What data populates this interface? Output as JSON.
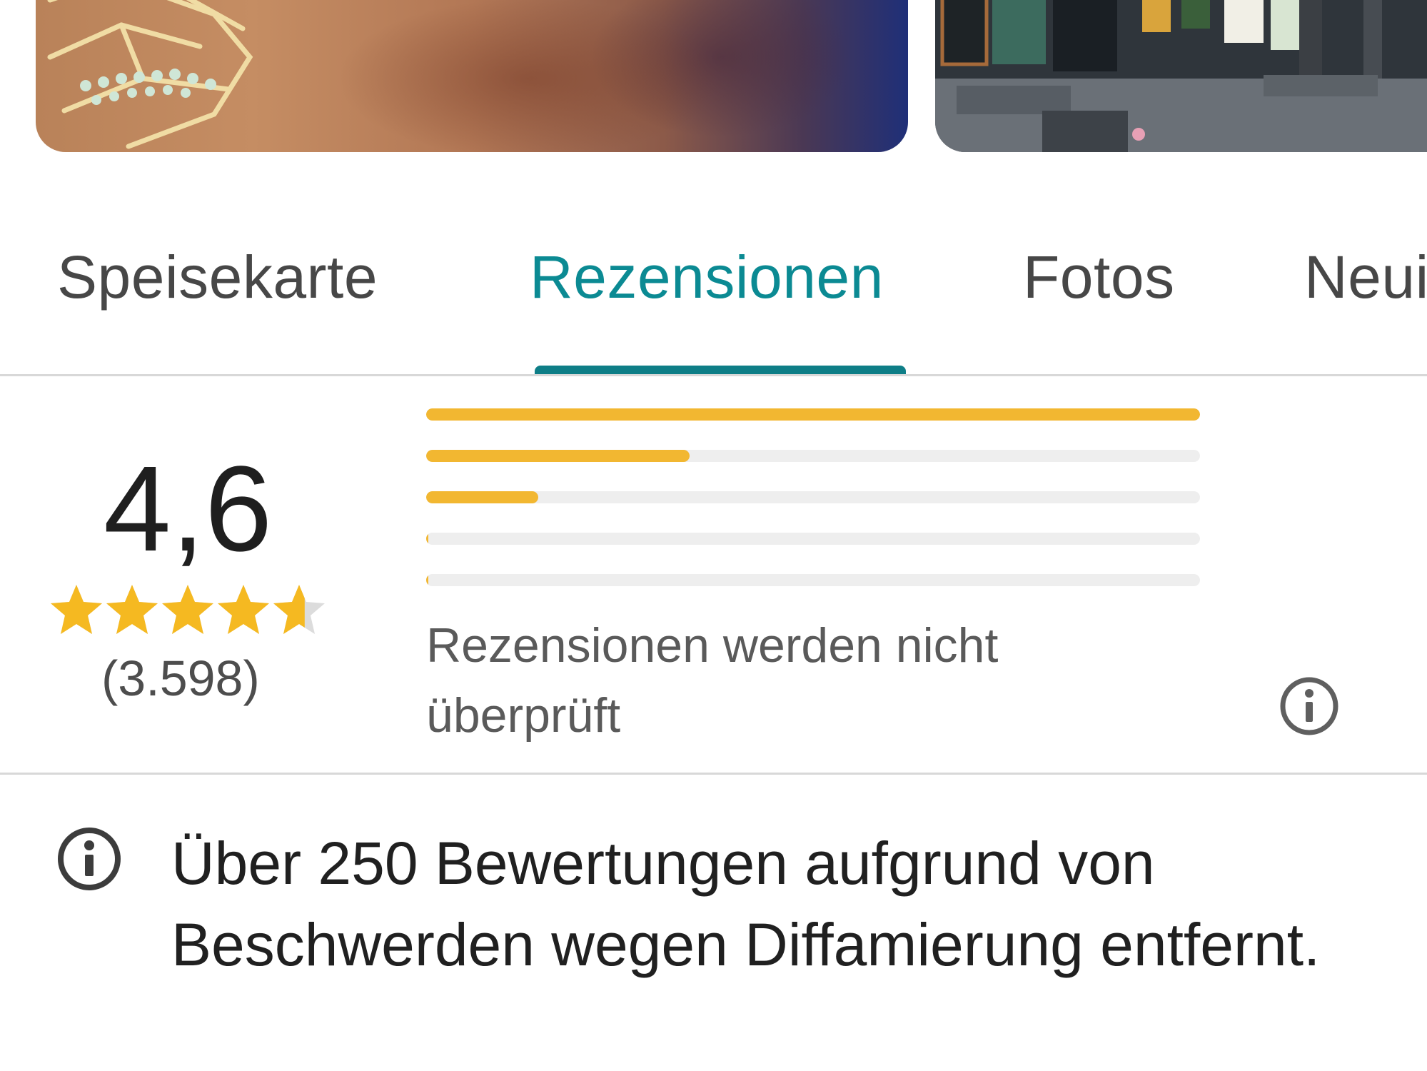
{
  "photos": [
    {
      "name": "food-photo",
      "icon": "food-photo-image"
    },
    {
      "name": "storefront-photo",
      "icon": "storefront-photo-image"
    }
  ],
  "tabs": [
    {
      "label": "Speisekarte",
      "active": false
    },
    {
      "label": "Rezensionen",
      "active": true
    },
    {
      "label": "Fotos",
      "active": false
    },
    {
      "label": "Neui",
      "active": false
    }
  ],
  "rating": {
    "score": "4,6",
    "stars": 4.6,
    "count": "(3.598)",
    "distribution": [
      {
        "stars": 5,
        "fraction": 1.0
      },
      {
        "stars": 4,
        "fraction": 0.34
      },
      {
        "stars": 3,
        "fraction": 0.145
      },
      {
        "stars": 2,
        "fraction": 0.003
      },
      {
        "stars": 1,
        "fraction": 0.003
      }
    ],
    "not_verified": "Rezensionen werden nicht überprüft",
    "info_icon": "info-icon"
  },
  "notice": {
    "icon": "info-icon",
    "text": "Über 250 Bewertungen aufgrund von Beschwerden wegen Diffamierung entfernt."
  },
  "colors": {
    "accent": "#0b8a93",
    "star": "#f5b921",
    "bar_fill": "#f2b731",
    "bar_track": "#eeeeee"
  }
}
